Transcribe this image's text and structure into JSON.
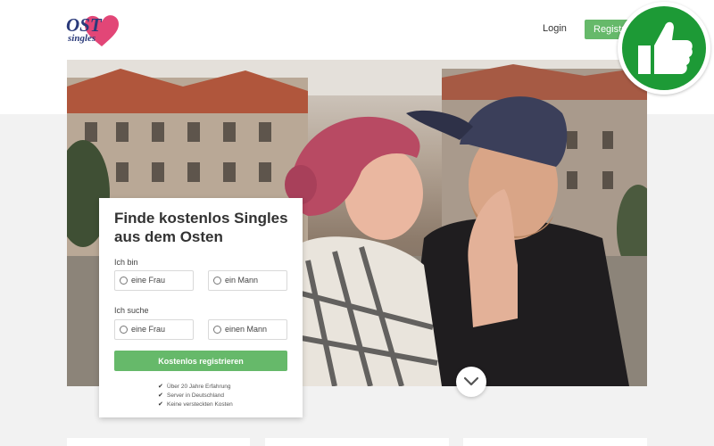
{
  "header": {
    "logo": {
      "text_top": "OST",
      "text_bottom": "singles"
    },
    "login_label": "Login",
    "register_label": "Registrieren"
  },
  "badge": {
    "icon": "thumbs-up-icon",
    "color": "#1d9a36"
  },
  "hero": {
    "image": "couple-embracing-photo"
  },
  "signup": {
    "title": "Finde kostenlos Singles aus dem Osten",
    "i_am_label": "Ich bin",
    "i_am_options": [
      "eine Frau",
      "ein Mann"
    ],
    "looking_for_label": "Ich suche",
    "looking_for_options": [
      "eine Frau",
      "einen Mann"
    ],
    "submit_label": "Kostenlos registrieren",
    "features": [
      "Über 20 Jahre Erfahrung",
      "Server in Deutschland",
      "Keine versteckten Kosten"
    ]
  },
  "colors": {
    "accent": "#66b96a",
    "brand": "#2a3a7a",
    "logo_heart": "#e0366b"
  }
}
